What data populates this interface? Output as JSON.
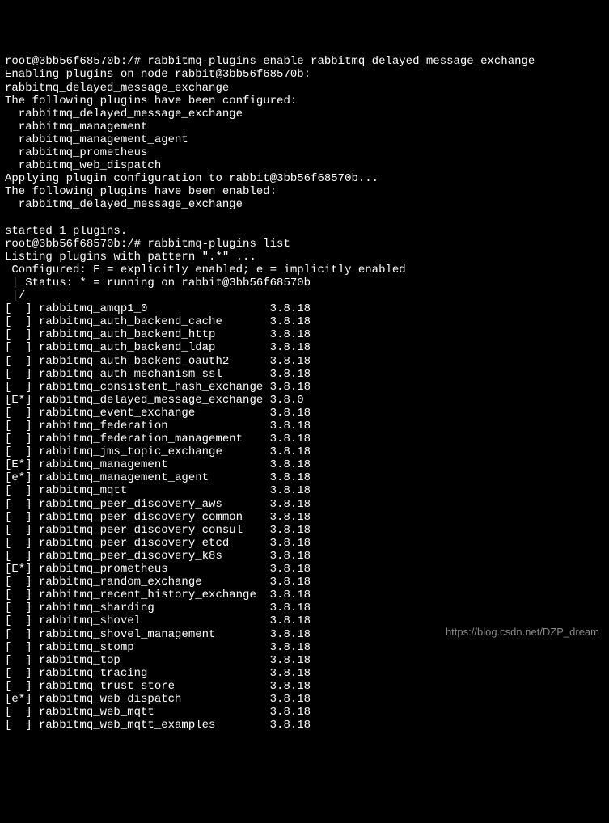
{
  "header_lines": [
    "root@3bb56f68570b:/# rabbitmq-plugins enable rabbitmq_delayed_message_exchange",
    "Enabling plugins on node rabbit@3bb56f68570b:",
    "rabbitmq_delayed_message_exchange",
    "The following plugins have been configured:",
    "  rabbitmq_delayed_message_exchange",
    "  rabbitmq_management",
    "  rabbitmq_management_agent",
    "  rabbitmq_prometheus",
    "  rabbitmq_web_dispatch",
    "Applying plugin configuration to rabbit@3bb56f68570b...",
    "The following plugins have been enabled:",
    "  rabbitmq_delayed_message_exchange",
    "",
    "started 1 plugins.",
    "root@3bb56f68570b:/# rabbitmq-plugins list",
    "Listing plugins with pattern \".*\" ...",
    " Configured: E = explicitly enabled; e = implicitly enabled",
    " | Status: * = running on rabbit@3bb56f68570b",
    " |/"
  ],
  "plugins": [
    {
      "flags": "[  ]",
      "name": "rabbitmq_amqp1_0",
      "version": "3.8.18"
    },
    {
      "flags": "[  ]",
      "name": "rabbitmq_auth_backend_cache",
      "version": "3.8.18"
    },
    {
      "flags": "[  ]",
      "name": "rabbitmq_auth_backend_http",
      "version": "3.8.18"
    },
    {
      "flags": "[  ]",
      "name": "rabbitmq_auth_backend_ldap",
      "version": "3.8.18"
    },
    {
      "flags": "[  ]",
      "name": "rabbitmq_auth_backend_oauth2",
      "version": "3.8.18"
    },
    {
      "flags": "[  ]",
      "name": "rabbitmq_auth_mechanism_ssl",
      "version": "3.8.18"
    },
    {
      "flags": "[  ]",
      "name": "rabbitmq_consistent_hash_exchange",
      "version": "3.8.18"
    },
    {
      "flags": "[E*]",
      "name": "rabbitmq_delayed_message_exchange",
      "version": "3.8.0"
    },
    {
      "flags": "[  ]",
      "name": "rabbitmq_event_exchange",
      "version": "3.8.18"
    },
    {
      "flags": "[  ]",
      "name": "rabbitmq_federation",
      "version": "3.8.18"
    },
    {
      "flags": "[  ]",
      "name": "rabbitmq_federation_management",
      "version": "3.8.18"
    },
    {
      "flags": "[  ]",
      "name": "rabbitmq_jms_topic_exchange",
      "version": "3.8.18"
    },
    {
      "flags": "[E*]",
      "name": "rabbitmq_management",
      "version": "3.8.18"
    },
    {
      "flags": "[e*]",
      "name": "rabbitmq_management_agent",
      "version": "3.8.18"
    },
    {
      "flags": "[  ]",
      "name": "rabbitmq_mqtt",
      "version": "3.8.18"
    },
    {
      "flags": "[  ]",
      "name": "rabbitmq_peer_discovery_aws",
      "version": "3.8.18"
    },
    {
      "flags": "[  ]",
      "name": "rabbitmq_peer_discovery_common",
      "version": "3.8.18"
    },
    {
      "flags": "[  ]",
      "name": "rabbitmq_peer_discovery_consul",
      "version": "3.8.18"
    },
    {
      "flags": "[  ]",
      "name": "rabbitmq_peer_discovery_etcd",
      "version": "3.8.18"
    },
    {
      "flags": "[  ]",
      "name": "rabbitmq_peer_discovery_k8s",
      "version": "3.8.18"
    },
    {
      "flags": "[E*]",
      "name": "rabbitmq_prometheus",
      "version": "3.8.18"
    },
    {
      "flags": "[  ]",
      "name": "rabbitmq_random_exchange",
      "version": "3.8.18"
    },
    {
      "flags": "[  ]",
      "name": "rabbitmq_recent_history_exchange",
      "version": "3.8.18"
    },
    {
      "flags": "[  ]",
      "name": "rabbitmq_sharding",
      "version": "3.8.18"
    },
    {
      "flags": "[  ]",
      "name": "rabbitmq_shovel",
      "version": "3.8.18"
    },
    {
      "flags": "[  ]",
      "name": "rabbitmq_shovel_management",
      "version": "3.8.18"
    },
    {
      "flags": "[  ]",
      "name": "rabbitmq_stomp",
      "version": "3.8.18"
    },
    {
      "flags": "[  ]",
      "name": "rabbitmq_top",
      "version": "3.8.18"
    },
    {
      "flags": "[  ]",
      "name": "rabbitmq_tracing",
      "version": "3.8.18"
    },
    {
      "flags": "[  ]",
      "name": "rabbitmq_trust_store",
      "version": "3.8.18"
    },
    {
      "flags": "[e*]",
      "name": "rabbitmq_web_dispatch",
      "version": "3.8.18"
    },
    {
      "flags": "[  ]",
      "name": "rabbitmq_web_mqtt",
      "version": "3.8.18"
    },
    {
      "flags": "[  ]",
      "name": "rabbitmq_web_mqtt_examples",
      "version": "3.8.18"
    }
  ],
  "watermark": "https://blog.csdn.net/DZP_dream"
}
